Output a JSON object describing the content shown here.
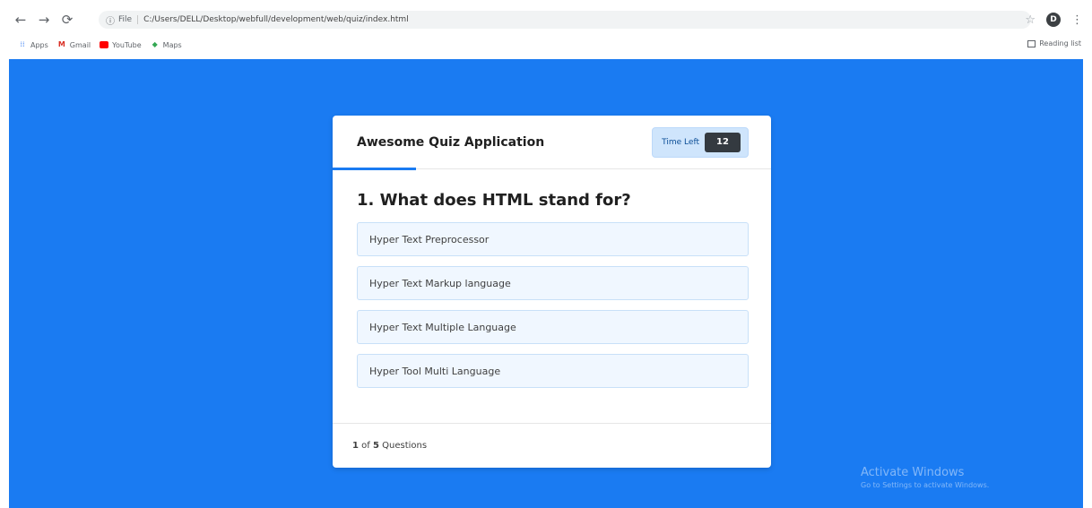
{
  "browser": {
    "url_scheme": "File",
    "url": "C:/Users/DELL/Desktop/webfull/development/web/quiz/index.html",
    "bookmarks": [
      "Apps",
      "Gmail",
      "YouTube",
      "Maps"
    ],
    "reading_list": "Reading list",
    "profile_initial": "D"
  },
  "quiz": {
    "title": "Awesome Quiz Application",
    "timer_label": "Time Left",
    "timer_value": "12",
    "time_progress_fraction": 0.19,
    "question": "1. What does HTML stand for?",
    "options": [
      "Hyper Text Preprocessor",
      "Hyper Text Markup language",
      "Hyper Text Multiple Language",
      "Hyper Tool Multi Language"
    ],
    "progress_current": "1",
    "progress_of": "of",
    "progress_total": "5",
    "progress_label": "Questions"
  },
  "watermark": {
    "title": "Activate Windows",
    "subtitle": "Go to Settings to activate Windows."
  },
  "colors": {
    "page_background": "#1a7bf2",
    "timer_background": "#cfe5fc",
    "timer_value_background": "#343a40",
    "option_background": "#f0f7ff"
  }
}
